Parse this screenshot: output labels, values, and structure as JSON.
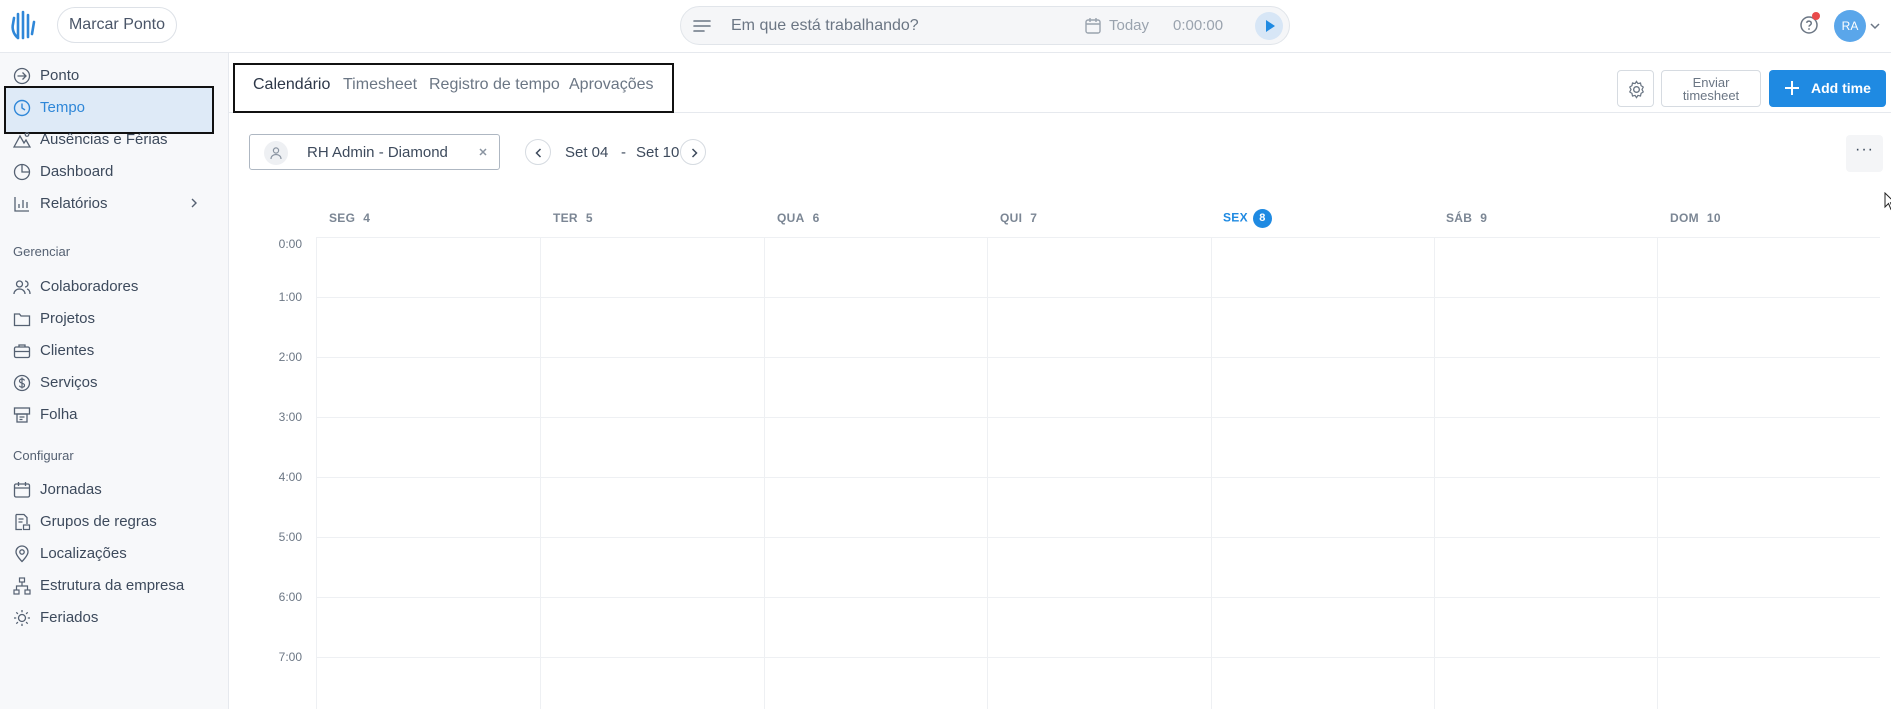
{
  "colors": {
    "accent": "#1f8ae2",
    "active_bg": "#deeaf7",
    "notification_dot": "#e94b4b"
  },
  "topbar": {
    "logo_icon": "hand-logo-icon",
    "marcar_label": "Marcar Ponto",
    "task_placeholder": "Em que está trabalhando?",
    "today_label": "Today",
    "timer": "0:00:00",
    "avatar_initials": "RA"
  },
  "sidebar": {
    "items": [
      {
        "label": "Ponto",
        "icon": "clock-in-icon"
      },
      {
        "label": "Tempo",
        "icon": "clock-icon"
      },
      {
        "label": "Ausências e Férias",
        "icon": "mountain-icon"
      },
      {
        "label": "Dashboard",
        "icon": "pie-chart-icon"
      },
      {
        "label": "Relatórios",
        "icon": "bar-chart-icon"
      }
    ],
    "section_manage": "Gerenciar",
    "manage_items": [
      {
        "label": "Colaboradores",
        "icon": "users-icon"
      },
      {
        "label": "Projetos",
        "icon": "folder-icon"
      },
      {
        "label": "Clientes",
        "icon": "briefcase-icon"
      },
      {
        "label": "Serviços",
        "icon": "dollar-icon"
      },
      {
        "label": "Folha",
        "icon": "payroll-icon"
      }
    ],
    "section_config": "Configurar",
    "config_items": [
      {
        "label": "Jornadas",
        "icon": "calendar-icon"
      },
      {
        "label": "Grupos de regras",
        "icon": "rules-icon"
      },
      {
        "label": "Localizações",
        "icon": "location-icon"
      },
      {
        "label": "Estrutura da empresa",
        "icon": "org-chart-icon"
      },
      {
        "label": "Feriados",
        "icon": "sun-icon"
      }
    ]
  },
  "tabs": [
    {
      "label": "Calendário",
      "active": true
    },
    {
      "label": "Timesheet",
      "active": false
    },
    {
      "label": "Registro de tempo",
      "active": false
    },
    {
      "label": "Aprovações",
      "active": false
    }
  ],
  "actions": {
    "enviar_line1": "Enviar",
    "enviar_line2": "timesheet",
    "add_time": "Add time",
    "more": "···"
  },
  "filter": {
    "user_name": "RH Admin - Diamond",
    "range_start": "Set 04",
    "range_sep": "-",
    "range_end": "Set 10"
  },
  "calendar": {
    "days": [
      {
        "name": "SEG",
        "num": "4"
      },
      {
        "name": "TER",
        "num": "5"
      },
      {
        "name": "QUA",
        "num": "6"
      },
      {
        "name": "QUI",
        "num": "7"
      },
      {
        "name": "SEX",
        "num": "8",
        "today": true
      },
      {
        "name": "SÁB",
        "num": "9"
      },
      {
        "name": "DOM",
        "num": "10"
      }
    ],
    "hours": [
      "0:00",
      "1:00",
      "2:00",
      "3:00",
      "4:00",
      "5:00",
      "6:00",
      "7:00"
    ]
  }
}
